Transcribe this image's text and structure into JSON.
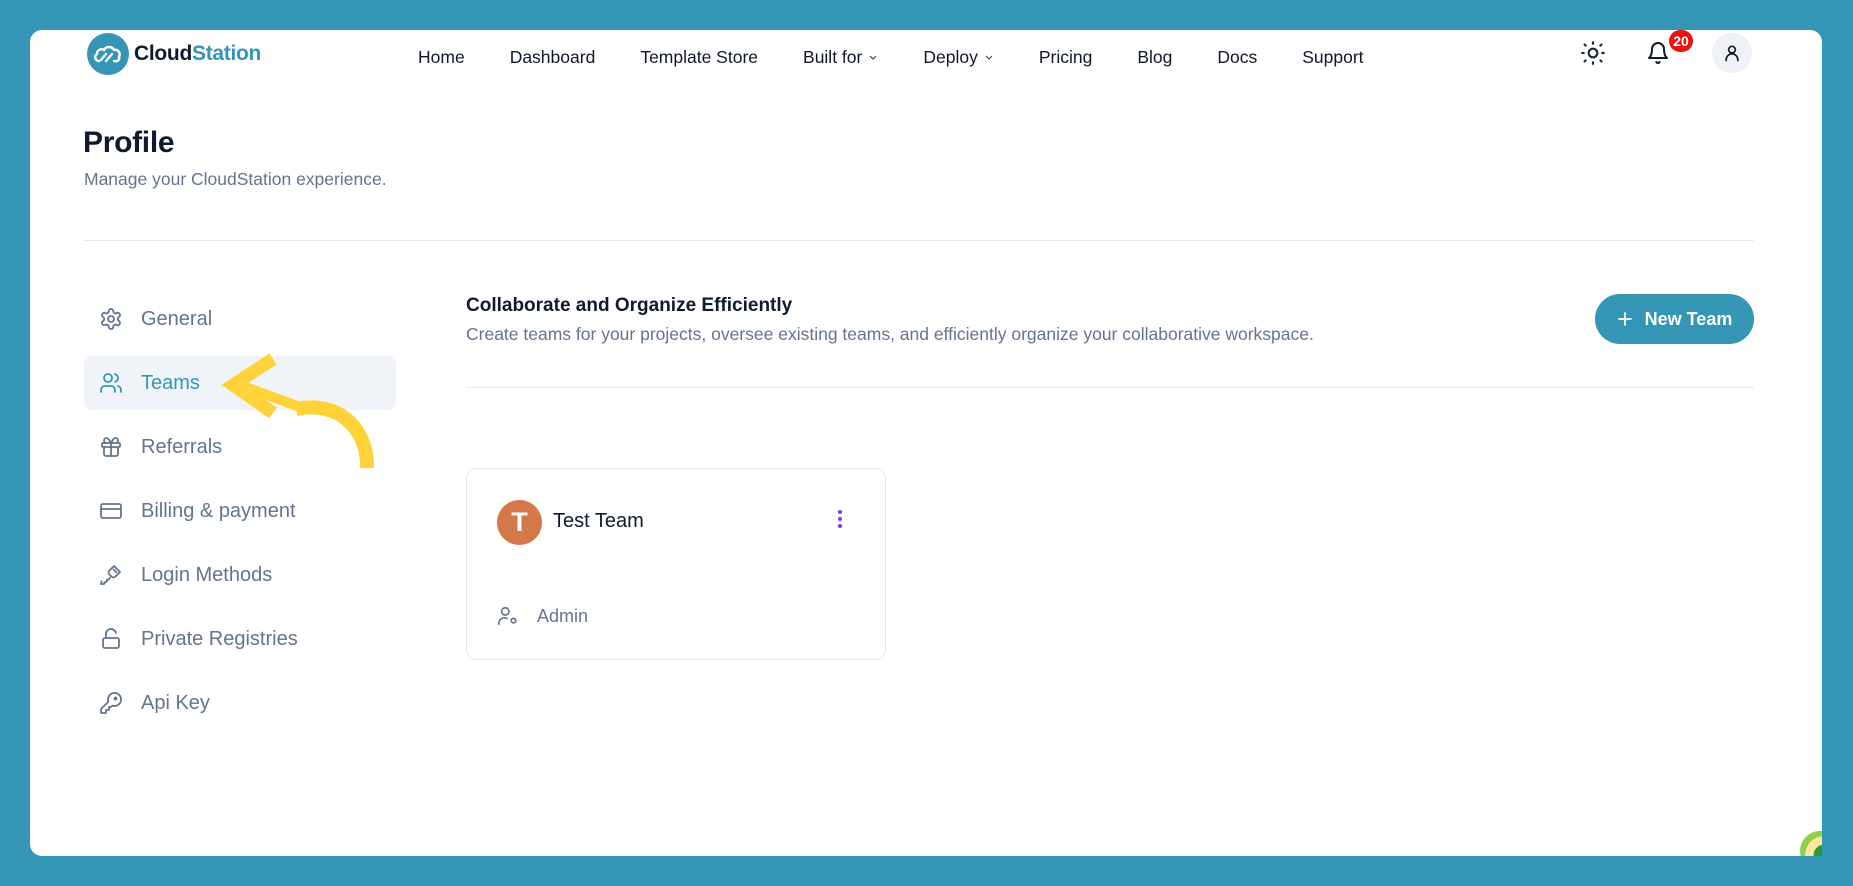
{
  "brand": {
    "name_part1": "Cloud",
    "name_part2": "Station",
    "primary_color": "#3595b5",
    "dark_color": "#0f1a2e"
  },
  "nav": {
    "items": [
      {
        "label": "Home",
        "has_dropdown": false
      },
      {
        "label": "Dashboard",
        "has_dropdown": false
      },
      {
        "label": "Template Store",
        "has_dropdown": false
      },
      {
        "label": "Built for",
        "has_dropdown": true
      },
      {
        "label": "Deploy",
        "has_dropdown": true
      },
      {
        "label": "Pricing",
        "has_dropdown": false
      },
      {
        "label": "Blog",
        "has_dropdown": false
      },
      {
        "label": "Docs",
        "has_dropdown": false
      },
      {
        "label": "Support",
        "has_dropdown": false
      }
    ],
    "theme_icon": "sun-icon",
    "notifications_icon": "bell-icon",
    "notification_count": "20",
    "user_icon": "user-icon"
  },
  "page": {
    "title": "Profile",
    "subtitle": "Manage your CloudStation experience."
  },
  "sidebar": {
    "items": [
      {
        "label": "General",
        "icon": "gear-icon",
        "active": false
      },
      {
        "label": "Teams",
        "icon": "users-icon",
        "active": true
      },
      {
        "label": "Referrals",
        "icon": "gift-icon",
        "active": false
      },
      {
        "label": "Billing & payment",
        "icon": "credit-card-icon",
        "active": false
      },
      {
        "label": "Login Methods",
        "icon": "key-icon",
        "active": false
      },
      {
        "label": "Private Registries",
        "icon": "unlock-icon",
        "active": false
      },
      {
        "label": "Api Key",
        "icon": "key-round-icon",
        "active": false
      }
    ]
  },
  "content": {
    "title": "Collaborate and Organize Efficiently",
    "subtitle": "Create teams for your projects, oversee existing teams, and efficiently organize your collaborative workspace.",
    "new_team_label": "New Team",
    "teams": [
      {
        "initial": "T",
        "name": "Test Team",
        "role": "Admin",
        "avatar_color": "#d4784a"
      }
    ]
  },
  "annotation": {
    "arrow_color": "#ffd23a",
    "points_to": "Teams"
  }
}
